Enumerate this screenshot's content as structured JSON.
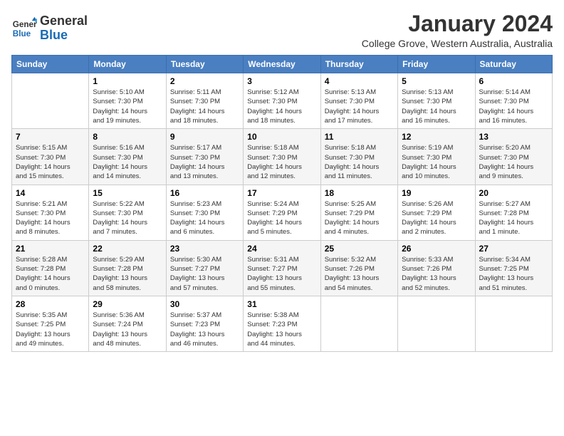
{
  "logo": {
    "line1": "General",
    "line2": "Blue"
  },
  "title": "January 2024",
  "subtitle": "College Grove, Western Australia, Australia",
  "headers": [
    "Sunday",
    "Monday",
    "Tuesday",
    "Wednesday",
    "Thursday",
    "Friday",
    "Saturday"
  ],
  "weeks": [
    [
      {
        "day": "",
        "info": ""
      },
      {
        "day": "1",
        "info": "Sunrise: 5:10 AM\nSunset: 7:30 PM\nDaylight: 14 hours\nand 19 minutes."
      },
      {
        "day": "2",
        "info": "Sunrise: 5:11 AM\nSunset: 7:30 PM\nDaylight: 14 hours\nand 18 minutes."
      },
      {
        "day": "3",
        "info": "Sunrise: 5:12 AM\nSunset: 7:30 PM\nDaylight: 14 hours\nand 18 minutes."
      },
      {
        "day": "4",
        "info": "Sunrise: 5:13 AM\nSunset: 7:30 PM\nDaylight: 14 hours\nand 17 minutes."
      },
      {
        "day": "5",
        "info": "Sunrise: 5:13 AM\nSunset: 7:30 PM\nDaylight: 14 hours\nand 16 minutes."
      },
      {
        "day": "6",
        "info": "Sunrise: 5:14 AM\nSunset: 7:30 PM\nDaylight: 14 hours\nand 16 minutes."
      }
    ],
    [
      {
        "day": "7",
        "info": "Sunrise: 5:15 AM\nSunset: 7:30 PM\nDaylight: 14 hours\nand 15 minutes."
      },
      {
        "day": "8",
        "info": "Sunrise: 5:16 AM\nSunset: 7:30 PM\nDaylight: 14 hours\nand 14 minutes."
      },
      {
        "day": "9",
        "info": "Sunrise: 5:17 AM\nSunset: 7:30 PM\nDaylight: 14 hours\nand 13 minutes."
      },
      {
        "day": "10",
        "info": "Sunrise: 5:18 AM\nSunset: 7:30 PM\nDaylight: 14 hours\nand 12 minutes."
      },
      {
        "day": "11",
        "info": "Sunrise: 5:18 AM\nSunset: 7:30 PM\nDaylight: 14 hours\nand 11 minutes."
      },
      {
        "day": "12",
        "info": "Sunrise: 5:19 AM\nSunset: 7:30 PM\nDaylight: 14 hours\nand 10 minutes."
      },
      {
        "day": "13",
        "info": "Sunrise: 5:20 AM\nSunset: 7:30 PM\nDaylight: 14 hours\nand 9 minutes."
      }
    ],
    [
      {
        "day": "14",
        "info": "Sunrise: 5:21 AM\nSunset: 7:30 PM\nDaylight: 14 hours\nand 8 minutes."
      },
      {
        "day": "15",
        "info": "Sunrise: 5:22 AM\nSunset: 7:30 PM\nDaylight: 14 hours\nand 7 minutes."
      },
      {
        "day": "16",
        "info": "Sunrise: 5:23 AM\nSunset: 7:30 PM\nDaylight: 14 hours\nand 6 minutes."
      },
      {
        "day": "17",
        "info": "Sunrise: 5:24 AM\nSunset: 7:29 PM\nDaylight: 14 hours\nand 5 minutes."
      },
      {
        "day": "18",
        "info": "Sunrise: 5:25 AM\nSunset: 7:29 PM\nDaylight: 14 hours\nand 4 minutes."
      },
      {
        "day": "19",
        "info": "Sunrise: 5:26 AM\nSunset: 7:29 PM\nDaylight: 14 hours\nand 2 minutes."
      },
      {
        "day": "20",
        "info": "Sunrise: 5:27 AM\nSunset: 7:28 PM\nDaylight: 14 hours\nand 1 minute."
      }
    ],
    [
      {
        "day": "21",
        "info": "Sunrise: 5:28 AM\nSunset: 7:28 PM\nDaylight: 14 hours\nand 0 minutes."
      },
      {
        "day": "22",
        "info": "Sunrise: 5:29 AM\nSunset: 7:28 PM\nDaylight: 13 hours\nand 58 minutes."
      },
      {
        "day": "23",
        "info": "Sunrise: 5:30 AM\nSunset: 7:27 PM\nDaylight: 13 hours\nand 57 minutes."
      },
      {
        "day": "24",
        "info": "Sunrise: 5:31 AM\nSunset: 7:27 PM\nDaylight: 13 hours\nand 55 minutes."
      },
      {
        "day": "25",
        "info": "Sunrise: 5:32 AM\nSunset: 7:26 PM\nDaylight: 13 hours\nand 54 minutes."
      },
      {
        "day": "26",
        "info": "Sunrise: 5:33 AM\nSunset: 7:26 PM\nDaylight: 13 hours\nand 52 minutes."
      },
      {
        "day": "27",
        "info": "Sunrise: 5:34 AM\nSunset: 7:25 PM\nDaylight: 13 hours\nand 51 minutes."
      }
    ],
    [
      {
        "day": "28",
        "info": "Sunrise: 5:35 AM\nSunset: 7:25 PM\nDaylight: 13 hours\nand 49 minutes."
      },
      {
        "day": "29",
        "info": "Sunrise: 5:36 AM\nSunset: 7:24 PM\nDaylight: 13 hours\nand 48 minutes."
      },
      {
        "day": "30",
        "info": "Sunrise: 5:37 AM\nSunset: 7:23 PM\nDaylight: 13 hours\nand 46 minutes."
      },
      {
        "day": "31",
        "info": "Sunrise: 5:38 AM\nSunset: 7:23 PM\nDaylight: 13 hours\nand 44 minutes."
      },
      {
        "day": "",
        "info": ""
      },
      {
        "day": "",
        "info": ""
      },
      {
        "day": "",
        "info": ""
      }
    ]
  ]
}
